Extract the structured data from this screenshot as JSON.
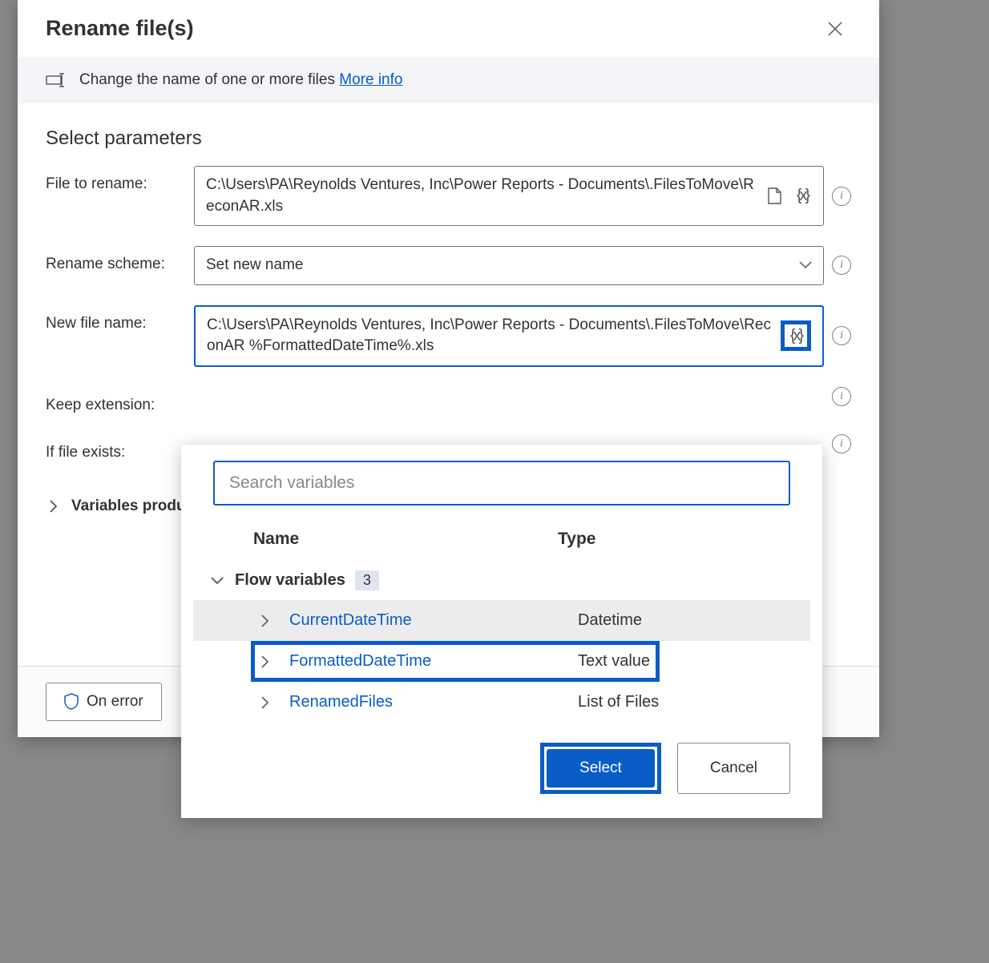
{
  "dialog": {
    "title": "Rename file(s)",
    "description_text": "Change the name of one or more files ",
    "more_info_label": "More info",
    "section_title": "Select parameters",
    "params": {
      "file_to_rename_label": "File to rename:",
      "file_to_rename_value": "C:\\Users\\PA\\Reynolds Ventures, Inc\\Power Reports - Documents\\.FilesToMove\\ReconAR.xls",
      "rename_scheme_label": "Rename scheme:",
      "rename_scheme_value": "Set new name",
      "new_file_name_label": "New file name:",
      "new_file_name_value": "C:\\Users\\PA\\Reynolds Ventures, Inc\\Power Reports - Documents\\.FilesToMove\\ReconAR %FormattedDateTime%.xls",
      "keep_extension_label": "Keep extension:",
      "if_file_exists_label": "If file exists:"
    },
    "variables_produced_label": "Variables produ",
    "on_error_label": "On error"
  },
  "var_popup": {
    "search_placeholder": "Search variables",
    "col_name": "Name",
    "col_type": "Type",
    "group_label": "Flow variables",
    "group_count": "3",
    "variables": [
      {
        "name": "CurrentDateTime",
        "type": "Datetime",
        "selected": true,
        "highlighted": false
      },
      {
        "name": "FormattedDateTime",
        "type": "Text value",
        "selected": false,
        "highlighted": true
      },
      {
        "name": "RenamedFiles",
        "type": "List of Files",
        "selected": false,
        "highlighted": false
      }
    ],
    "select_label": "Select",
    "cancel_label": "Cancel"
  }
}
